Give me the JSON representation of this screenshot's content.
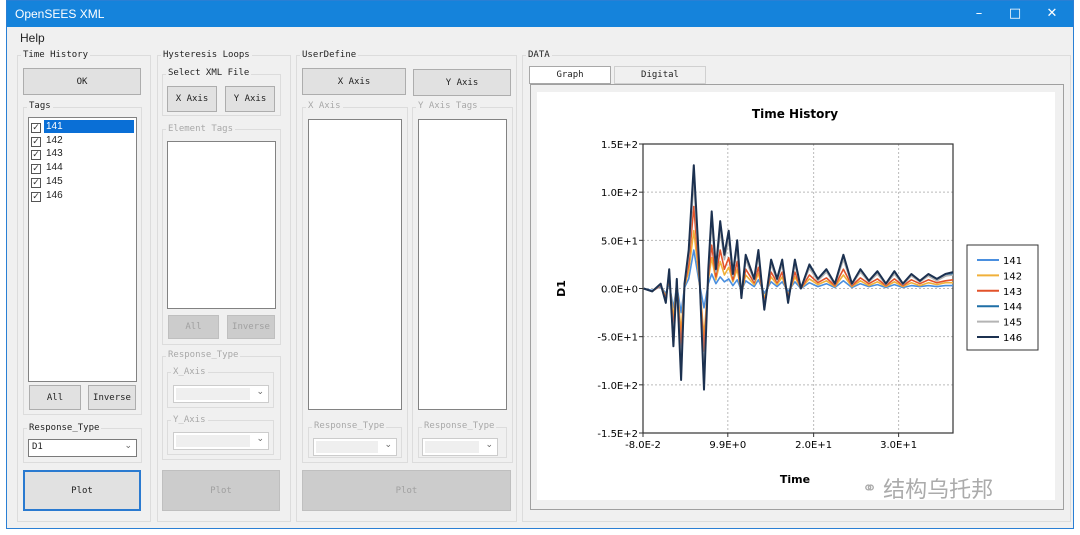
{
  "window": {
    "title": "OpenSEES XML",
    "controls": [
      "minimize",
      "maximize",
      "close"
    ]
  },
  "menu": {
    "help": "Help"
  },
  "time_history": {
    "title": "Time History",
    "ok": "OK",
    "tags_title": "Tags",
    "tags": [
      {
        "label": "141",
        "checked": true,
        "selected": true
      },
      {
        "label": "142",
        "checked": true
      },
      {
        "label": "143",
        "checked": true
      },
      {
        "label": "144",
        "checked": true
      },
      {
        "label": "145",
        "checked": true
      },
      {
        "label": "146",
        "checked": true
      }
    ],
    "all": "All",
    "inverse": "Inverse",
    "response_type_title": "Response_Type",
    "response_type_value": "D1",
    "plot": "Plot"
  },
  "hysteresis": {
    "title": "Hysteresis Loops",
    "select_xml": "Select XML File",
    "x_axis": "X Axis",
    "y_axis": "Y Axis",
    "element_tags": "Element Tags",
    "all": "All",
    "inverse": "Inverse",
    "response_type": "Response_Type",
    "x_axis_group": "X_Axis",
    "y_axis_group": "Y_Axis",
    "plot": "Plot"
  },
  "user_define": {
    "title": "UserDefine",
    "x_axis_btn": "X Axis",
    "y_axis_btn": "Y Axis",
    "x_axis_group": "X Axis",
    "y_axis_tags": "Y Axis Tags",
    "response_type_1": "Response_Type",
    "response_type_2": "Response_Type",
    "plot": "Plot"
  },
  "data_panel": {
    "title": "DATA",
    "tabs": [
      {
        "label": "Graph",
        "active": true
      },
      {
        "label": "Digital",
        "active": false
      }
    ]
  },
  "watermark": "结构乌托邦",
  "chart_data": {
    "type": "line",
    "title": "Time History",
    "xlabel": "Time",
    "ylabel": "D1",
    "xlim": [
      -0.08,
      36.4
    ],
    "ylim": [
      -150,
      150
    ],
    "xticks": [
      {
        "v": -0.08,
        "label": "-8.0E-2"
      },
      {
        "v": 9.9,
        "label": "9.9E+0"
      },
      {
        "v": 20,
        "label": "2.0E+1"
      },
      {
        "v": 30,
        "label": "3.0E+1"
      }
    ],
    "yticks": [
      {
        "v": 150,
        "label": "1.5E+2"
      },
      {
        "v": 100,
        "label": "1.0E+2"
      },
      {
        "v": 50,
        "label": "5.0E+1"
      },
      {
        "v": 0,
        "label": "0.0E+0"
      },
      {
        "v": -50,
        "label": "-5.0E+1"
      },
      {
        "v": -100,
        "label": "-1.0E+2"
      },
      {
        "v": -150,
        "label": "-1.5E+2"
      }
    ],
    "grid": true,
    "legend": "right",
    "x": [
      0,
      1,
      2,
      2.6,
      3,
      3.5,
      3.9,
      4.4,
      4.8,
      5.3,
      5.9,
      6.5,
      7.1,
      7.6,
      8.0,
      8.5,
      9.0,
      9.5,
      10.0,
      10.5,
      11.0,
      11.5,
      12.0,
      13.0,
      13.5,
      14.2,
      15.0,
      15.7,
      16.3,
      17.0,
      17.8,
      18.5,
      19.5,
      20.5,
      21.5,
      22.5,
      23.5,
      24.5,
      25.5,
      26.5,
      27.5,
      28.5,
      29.5,
      30.5,
      31.5,
      32.5,
      33.5,
      34.5,
      35.5,
      36.4
    ],
    "series": [
      {
        "name": "141",
        "color": "#4a8fdf",
        "values": [
          0,
          -2,
          2,
          -5,
          5,
          -20,
          3,
          -25,
          1,
          10,
          40,
          8,
          -20,
          5,
          15,
          5,
          12,
          7,
          10,
          3,
          9,
          -2,
          8,
          2,
          9,
          -5,
          7,
          2,
          7,
          -3,
          7,
          0,
          6,
          2,
          5,
          1,
          8,
          1,
          5,
          2,
          4,
          1,
          4,
          1,
          3,
          2,
          3,
          2,
          3,
          3
        ]
      },
      {
        "name": "142",
        "color": "#f0b03a",
        "values": [
          0,
          -3,
          3,
          -8,
          9,
          -30,
          5,
          -45,
          2,
          18,
          60,
          13,
          -50,
          9,
          32,
          9,
          28,
          14,
          22,
          7,
          20,
          -5,
          14,
          4,
          16,
          -10,
          12,
          4,
          12,
          -7,
          12,
          0,
          10,
          4,
          8,
          2,
          14,
          2,
          8,
          3,
          7,
          2,
          7,
          2,
          6,
          3,
          6,
          4,
          6,
          6
        ]
      },
      {
        "name": "143",
        "color": "#e2522a",
        "values": [
          0,
          -3,
          3,
          -10,
          12,
          -40,
          6,
          -60,
          3,
          25,
          85,
          18,
          -65,
          12,
          45,
          12,
          40,
          20,
          32,
          9,
          28,
          -6,
          20,
          6,
          22,
          -14,
          17,
          6,
          17,
          -9,
          17,
          0,
          14,
          6,
          11,
          3,
          20,
          3,
          11,
          5,
          10,
          3,
          10,
          3,
          9,
          5,
          9,
          6,
          8,
          9
        ]
      },
      {
        "name": "144",
        "color": "#1f6fa6",
        "values": [
          0,
          -3,
          4,
          -14,
          18,
          -55,
          9,
          -88,
          4,
          36,
          118,
          27,
          -95,
          18,
          72,
          18,
          63,
          31,
          54,
          13,
          45,
          -9,
          31,
          9,
          36,
          -20,
          27,
          9,
          27,
          -14,
          27,
          0,
          23,
          9,
          18,
          5,
          31,
          5,
          18,
          7,
          16,
          5,
          16,
          5,
          14,
          7,
          14,
          9,
          13,
          15
        ]
      },
      {
        "name": "145",
        "color": "#b4b4b4",
        "values": [
          0,
          -3,
          4,
          -13,
          17,
          -50,
          8,
          -80,
          4,
          34,
          110,
          25,
          -88,
          17,
          68,
          17,
          60,
          30,
          51,
          13,
          42,
          -8,
          30,
          8,
          34,
          -19,
          25,
          8,
          25,
          -13,
          25,
          0,
          21,
          8,
          17,
          4,
          30,
          4,
          17,
          7,
          15,
          4,
          15,
          4,
          13,
          7,
          13,
          8,
          13,
          14
        ]
      },
      {
        "name": "146",
        "color": "#1c3150",
        "values": [
          0,
          -3,
          5,
          -15,
          20,
          -60,
          10,
          -95,
          5,
          40,
          128,
          30,
          -105,
          20,
          80,
          20,
          70,
          35,
          60,
          15,
          50,
          -10,
          35,
          10,
          40,
          -22,
          30,
          10,
          30,
          -15,
          30,
          0,
          25,
          10,
          20,
          5,
          35,
          5,
          20,
          8,
          18,
          5,
          18,
          5,
          15,
          8,
          15,
          10,
          15,
          17
        ]
      }
    ]
  }
}
